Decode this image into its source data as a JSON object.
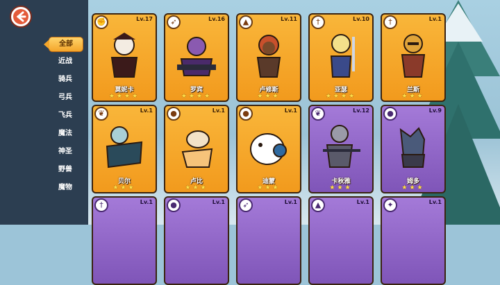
{
  "back_label": "back",
  "categories": [
    "全部",
    "近战",
    "骑兵",
    "弓兵",
    "飞兵",
    "魔法",
    "神圣",
    "野兽",
    "魔物"
  ],
  "active_category": "全部",
  "cards": [
    {
      "name": "莫妮卡",
      "level": "Lv.17",
      "stars": "★★★★",
      "theme": "orange",
      "class_icon": "fist"
    },
    {
      "name": "罗宾",
      "level": "Lv.16",
      "stars": "★★★★",
      "theme": "orange",
      "class_icon": "bow"
    },
    {
      "name": "卢修斯",
      "level": "Lv.11",
      "stars": "★★★",
      "theme": "orange",
      "class_icon": "wizard-hat"
    },
    {
      "name": "亚瑟",
      "level": "Lv.10",
      "stars": "★★★★",
      "theme": "orange",
      "class_icon": "sword"
    },
    {
      "name": "兰斯",
      "level": "Lv.1",
      "stars": "★★★",
      "theme": "orange",
      "class_icon": "sword"
    },
    {
      "name": "贝尔",
      "level": "Lv.1",
      "stars": "★★★",
      "theme": "orange",
      "class_icon": "wings"
    },
    {
      "name": "卢比",
      "level": "Lv.1",
      "stars": "★★★",
      "theme": "orange",
      "class_icon": "beast"
    },
    {
      "name": "迪蒙",
      "level": "Lv.1",
      "stars": "★★★",
      "theme": "orange",
      "class_icon": "beast"
    },
    {
      "name": "卡秋雅",
      "level": "Lv.12",
      "stars": "★★★",
      "theme": "purple",
      "class_icon": "wings"
    },
    {
      "name": "姆多",
      "level": "Lv.9",
      "stars": "★★★",
      "theme": "purple",
      "class_icon": "beast"
    },
    {
      "name": "",
      "level": "Lv.1",
      "stars": "",
      "theme": "purple",
      "class_icon": "sword"
    },
    {
      "name": "",
      "level": "Lv.1",
      "stars": "",
      "theme": "purple",
      "class_icon": "beast"
    },
    {
      "name": "",
      "level": "Lv.1",
      "stars": "",
      "theme": "purple",
      "class_icon": "bow"
    },
    {
      "name": "",
      "level": "Lv.1",
      "stars": "",
      "theme": "purple",
      "class_icon": "wizard-hat"
    },
    {
      "name": "",
      "level": "Lv.1",
      "stars": "",
      "theme": "purple",
      "class_icon": "holy"
    }
  ],
  "colors": {
    "sidebar": "#2c3e51",
    "card_orange": "#f4a42a",
    "card_purple": "#8e63c6",
    "star": "#ffe14a"
  }
}
